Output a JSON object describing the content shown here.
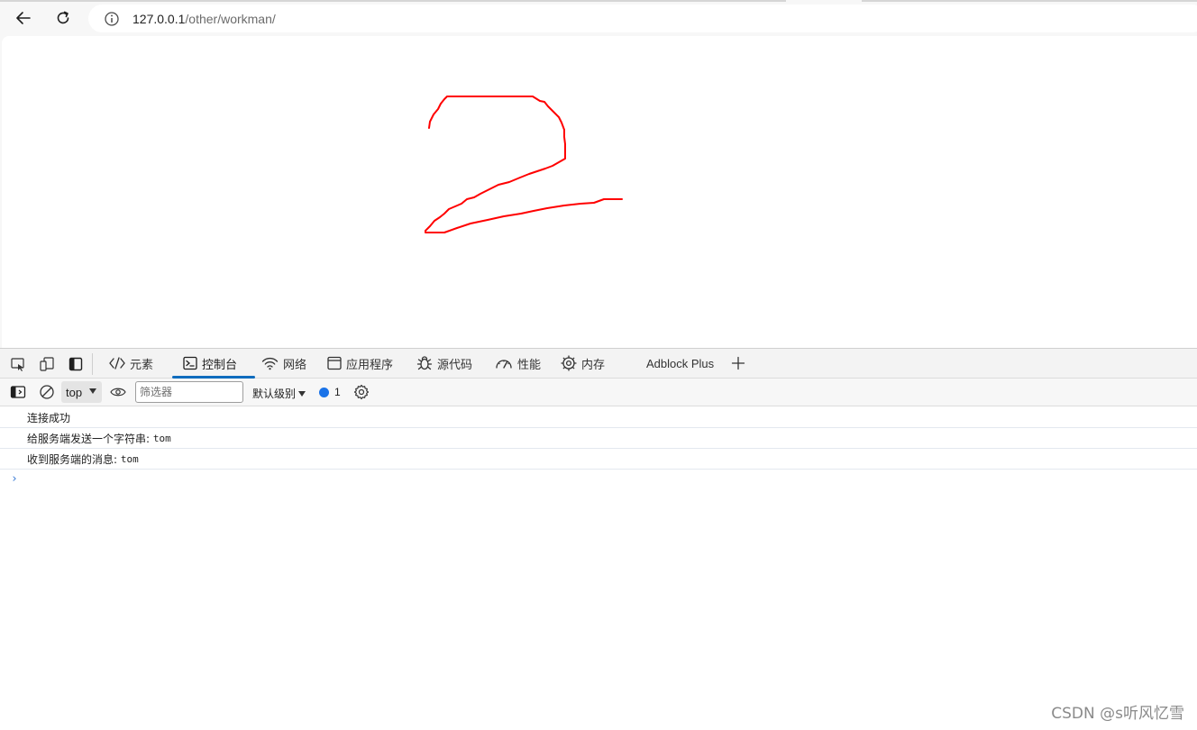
{
  "browser": {
    "url_host": "127.0.0.1",
    "url_path": "/other/workman/"
  },
  "drawing": {
    "stroke_color": "#ff0000",
    "shape": "handwritten digit 2"
  },
  "devtools": {
    "tabs": [
      {
        "label": "元素",
        "icon": "code-icon"
      },
      {
        "label": "控制台",
        "icon": "console-icon",
        "active": true
      },
      {
        "label": "网络",
        "icon": "wifi-icon"
      },
      {
        "label": "应用程序",
        "icon": "window-icon"
      },
      {
        "label": "源代码",
        "icon": "bug-icon"
      },
      {
        "label": "性能",
        "icon": "gauge-icon"
      },
      {
        "label": "内存",
        "icon": "chip-icon"
      },
      {
        "label": "Adblock Plus"
      }
    ],
    "accent_color": "#0f6cbd"
  },
  "console": {
    "context": "top",
    "filter_placeholder": "筛选器",
    "levels_label": "默认级别",
    "issues_count": "1",
    "messages": [
      {
        "text": "连接成功",
        "value": ""
      },
      {
        "text": "给服务端发送一个字符串:",
        "value": "tom"
      },
      {
        "text": "收到服务端的消息:",
        "value": "tom"
      }
    ],
    "prompt_symbol": "›"
  },
  "watermark": "CSDN @s听风忆雪"
}
